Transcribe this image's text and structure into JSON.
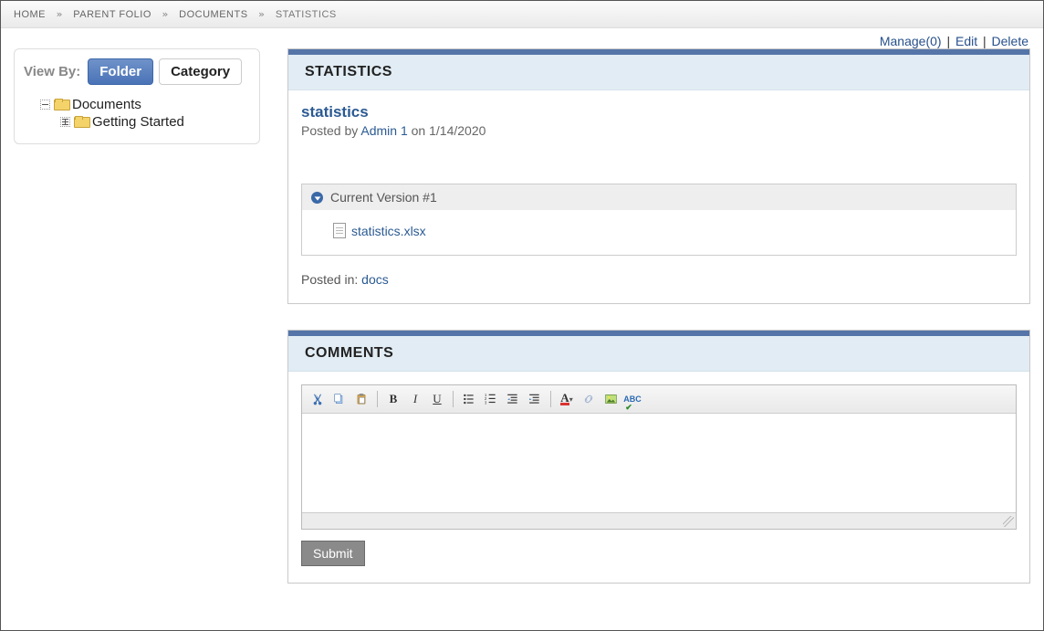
{
  "breadcrumb": [
    {
      "label": "HOME"
    },
    {
      "label": "PARENT FOLIO"
    },
    {
      "label": "DOCUMENTS"
    },
    {
      "label": "STATISTICS"
    }
  ],
  "actions": {
    "manage": "Manage(0)",
    "edit": "Edit",
    "delete": "Delete"
  },
  "sidebar": {
    "viewby_label": "View By:",
    "tab_folder": "Folder",
    "tab_category": "Category",
    "tree": {
      "root": "Documents",
      "child": "Getting Started"
    }
  },
  "doc_panel": {
    "header": "STATISTICS",
    "title": "statistics",
    "posted_by_prefix": "Posted by ",
    "author": "Admin 1",
    "on_word": " on ",
    "date": "1/14/2020",
    "version_label": "Current Version #1",
    "file_name": "statistics.xlsx",
    "posted_in_label": "Posted in: ",
    "posted_in_link": "docs"
  },
  "comments_panel": {
    "header": "COMMENTS",
    "submit": "Submit"
  }
}
